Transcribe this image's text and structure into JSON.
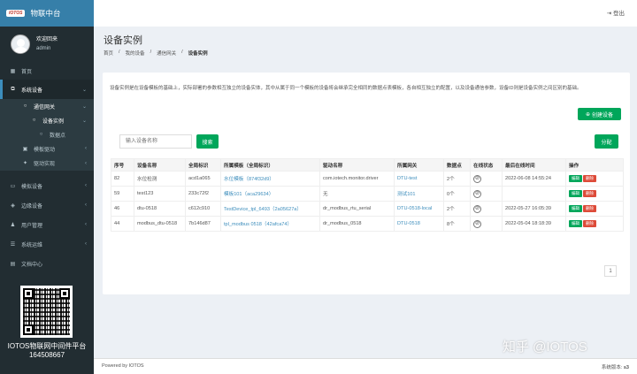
{
  "app": {
    "logo_badge": "IOTOS",
    "title": "物联中台"
  },
  "user": {
    "welcome": "欢迎回来",
    "name": "admin"
  },
  "sidebar": {
    "items": [
      {
        "label": "首页",
        "icon": "dashboard-icon"
      },
      {
        "label": "系统设备",
        "icon": "sitemap-icon"
      },
      {
        "label": "通信网关",
        "icon": "circle-icon"
      },
      {
        "label": "设备实例",
        "icon": "circle-icon"
      },
      {
        "label": "数据点",
        "icon": "circle-icon"
      },
      {
        "label": "模板驱动",
        "icon": "folder-icon"
      },
      {
        "label": "驱动实现",
        "icon": "share-icon"
      },
      {
        "label": "模拟设备",
        "icon": "tablet-icon"
      },
      {
        "label": "边缘设备",
        "icon": "cube-icon"
      },
      {
        "label": "用户管理",
        "icon": "users-icon"
      },
      {
        "label": "系统运维",
        "icon": "server-icon"
      },
      {
        "label": "文档中心",
        "icon": "file-icon"
      }
    ],
    "qr_caption": "IOTOS物联网中间件平台",
    "qr_number": "164508667"
  },
  "topbar": {
    "logout": "登出"
  },
  "page": {
    "title": "设备实例"
  },
  "breadcrumb": {
    "items": [
      "首页",
      "我的设备",
      "通信网关",
      "设备实例"
    ]
  },
  "main": {
    "description": "设备实例是在设备模板的基础上，实际部署的参数相互独立的设备实体，其中从属于同一个模板的设备将会继承完全相同的数据点表模板，各自相互独立的配置，以及设备通信参数，设备ID则是设备实例之间区别的基础。",
    "create_button": "创建设备",
    "search_placeholder": "输入设备名称",
    "search_button": "搜索",
    "assign_button": "分配",
    "columns": [
      "序号",
      "设备名称",
      "全局标识",
      "所属模板（全局标识）",
      "驱动名称",
      "所属网关",
      "数据点",
      "在线状态",
      "最后在线时间",
      "操作"
    ],
    "rows": [
      [
        "82",
        "水位检测",
        "acd1a065",
        "水位模板（874f32d9）",
        "com.iotech.monitor.driver",
        "DTU-test",
        "2个",
        "",
        "2022-06-08 14:55:24"
      ],
      [
        "59",
        "test123",
        "233c72f2",
        "模板101（aca29634）",
        "无",
        "测试101",
        "0个",
        "",
        ""
      ],
      [
        "46",
        "dtu-0518",
        "c612c910",
        "TestDevice_tpl_6493（2a05627a）",
        "dr_modbus_rtu_serial",
        "DTU-0518-local",
        "2个",
        "",
        "2022-05-27 16:05:39"
      ],
      [
        "44",
        "modbus_dtu-0518",
        "7b146d87",
        "tpl_modbus 0518（42afca74）",
        "dr_modbus_0518",
        "DTU-0518",
        "8个",
        "",
        "2022-05-04 18:18:39"
      ]
    ],
    "edit_label": "编辑",
    "delete_label": "删除",
    "offline_icon": "ban-icon",
    "page_number": "1"
  },
  "footer": {
    "powered": "Powered by IOTOS",
    "version_label": "系统版本:",
    "version": "s3"
  },
  "watermark": "知乎 @IOTOS",
  "colors": {
    "sidebar": "#222d32",
    "header": "#367fa9",
    "accent": "#3c8dbc",
    "success": "#00a65a",
    "danger": "#dd4b39"
  }
}
